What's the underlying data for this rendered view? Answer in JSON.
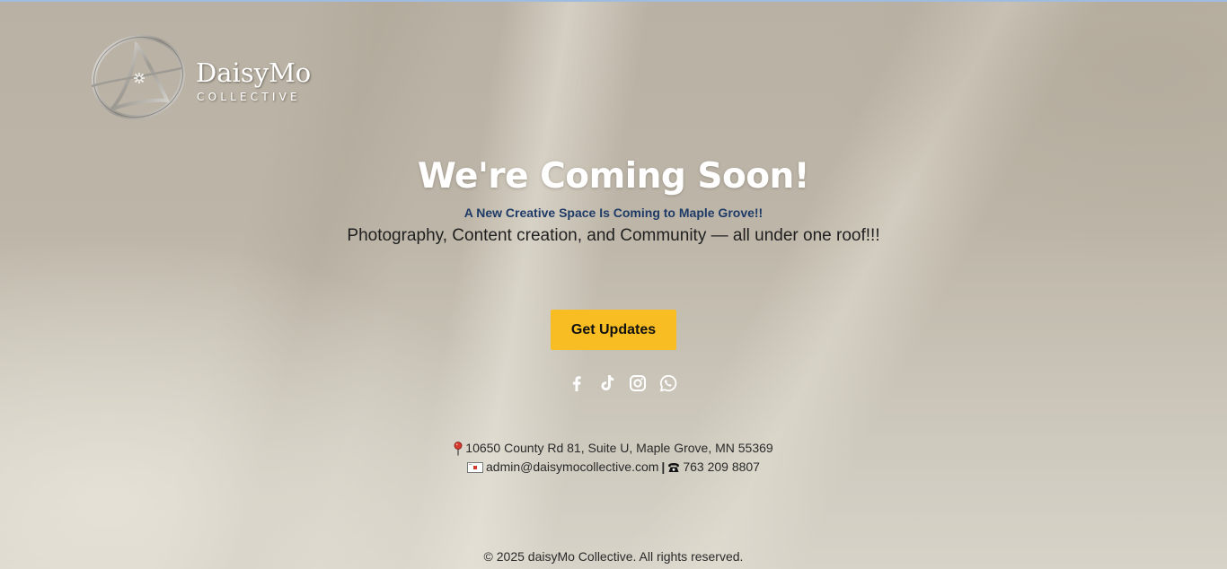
{
  "brand": {
    "name": "DaisyMo",
    "tagline": "COLLECTIVE"
  },
  "hero": {
    "title": "We're Coming Soon!",
    "subtitle": "A New Creative Space Is Coming to Maple Grove!!",
    "description": "Photography, Content creation, and Community — all under one roof!!!",
    "cta_label": "Get Updates"
  },
  "socials": [
    {
      "icon": "facebook-icon"
    },
    {
      "icon": "tiktok-icon"
    },
    {
      "icon": "instagram-icon"
    },
    {
      "icon": "whatsapp-icon"
    }
  ],
  "contact": {
    "address": "10650 County Rd 81, Suite U, Maple Grove, MN 55369",
    "email": "admin@daisymocollective.com",
    "separator": "|",
    "phone": "763 209 8807"
  },
  "footer": {
    "copyright": "© 2025 daisyMo Collective. All rights reserved."
  },
  "colors": {
    "accent": "#f7bd23",
    "subtitle": "#1e3a66",
    "title": "#ffffff"
  }
}
